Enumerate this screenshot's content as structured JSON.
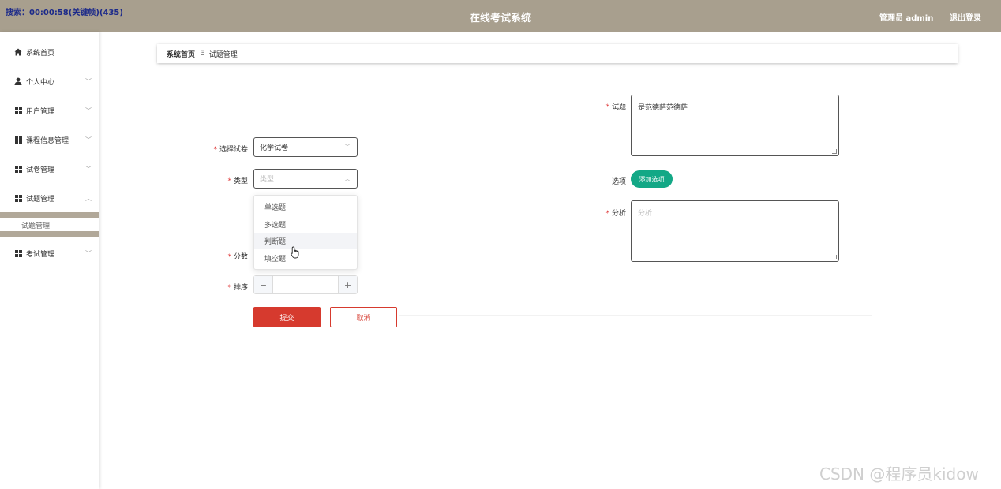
{
  "recording": "搜索：00:00:58(关键帧)(435)",
  "header": {
    "title": "在线考试系统",
    "admin": "管理员 admin",
    "logout": "退出登录"
  },
  "sidebar": {
    "items": [
      {
        "label": "系统首页",
        "icon": "home-icon"
      },
      {
        "label": "个人中心",
        "icon": "user-icon"
      },
      {
        "label": "用户管理",
        "icon": "grid-icon"
      },
      {
        "label": "课程信息管理",
        "icon": "grid-icon"
      },
      {
        "label": "试卷管理",
        "icon": "grid-icon"
      },
      {
        "label": "试题管理",
        "icon": "grid-icon"
      },
      {
        "label": "考试管理",
        "icon": "grid-icon"
      }
    ],
    "submenu": {
      "label": "试题管理"
    }
  },
  "breadcrumb": {
    "home": "系统首页",
    "separator": "Ξ",
    "current": "试题管理"
  },
  "form": {
    "paper": {
      "label": "选择试卷",
      "value": "化学试卷"
    },
    "type": {
      "label": "类型",
      "placeholder": "类型"
    },
    "type_options": [
      "单选题",
      "多选题",
      "判断题",
      "填空题"
    ],
    "hovered_option": "判断题",
    "score": {
      "label": "分数"
    },
    "order": {
      "label": "排序",
      "minus": "−",
      "plus": "+"
    },
    "question": {
      "label": "试题",
      "value": "是范德萨范德萨"
    },
    "options": {
      "label": "选项",
      "button": "添加选项"
    },
    "analysis": {
      "label": "分析",
      "placeholder": "分析"
    },
    "submit": "提交",
    "cancel": "取消"
  },
  "watermark": "CSDN @程序员kidow",
  "colors": {
    "header_bg": "#a89f8e",
    "primary_red": "#d63a2e",
    "teal": "#13a886",
    "required": "#e03c3c"
  }
}
